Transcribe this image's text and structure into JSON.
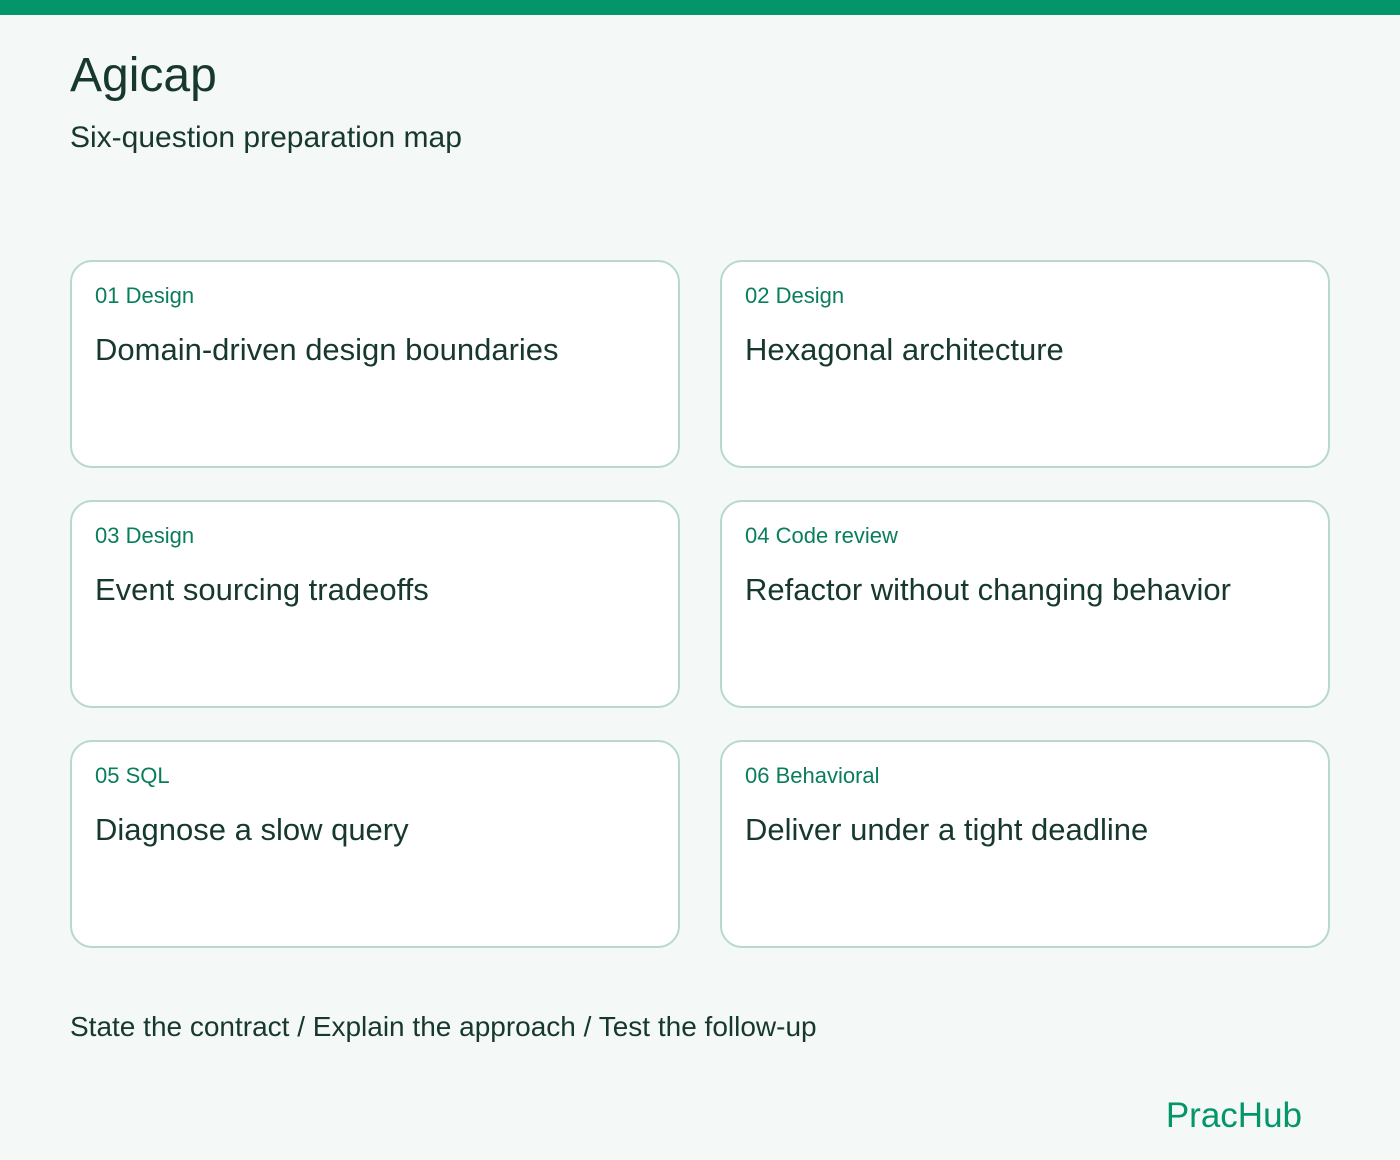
{
  "header": {
    "title": "Agicap",
    "subtitle": "Six-question preparation map"
  },
  "cards": [
    {
      "tag": "01 Design",
      "title": "Domain-driven design boundaries"
    },
    {
      "tag": "02 Design",
      "title": "Hexagonal architecture"
    },
    {
      "tag": "03 Design",
      "title": "Event sourcing tradeoffs"
    },
    {
      "tag": "04 Code review",
      "title": "Refactor without changing behavior"
    },
    {
      "tag": "05 SQL",
      "title": "Diagnose a slow query"
    },
    {
      "tag": "06 Behavioral",
      "title": "Deliver under a tight deadline"
    }
  ],
  "footer": {
    "steps_line": "State the contract / Explain the approach / Test the follow-up",
    "brand": "PracHub"
  },
  "colors": {
    "accent": "#04956b",
    "tag": "#0a7d5b",
    "text": "#17382f",
    "card_border": "#b9d8cd",
    "background": "#f4f8f6"
  }
}
